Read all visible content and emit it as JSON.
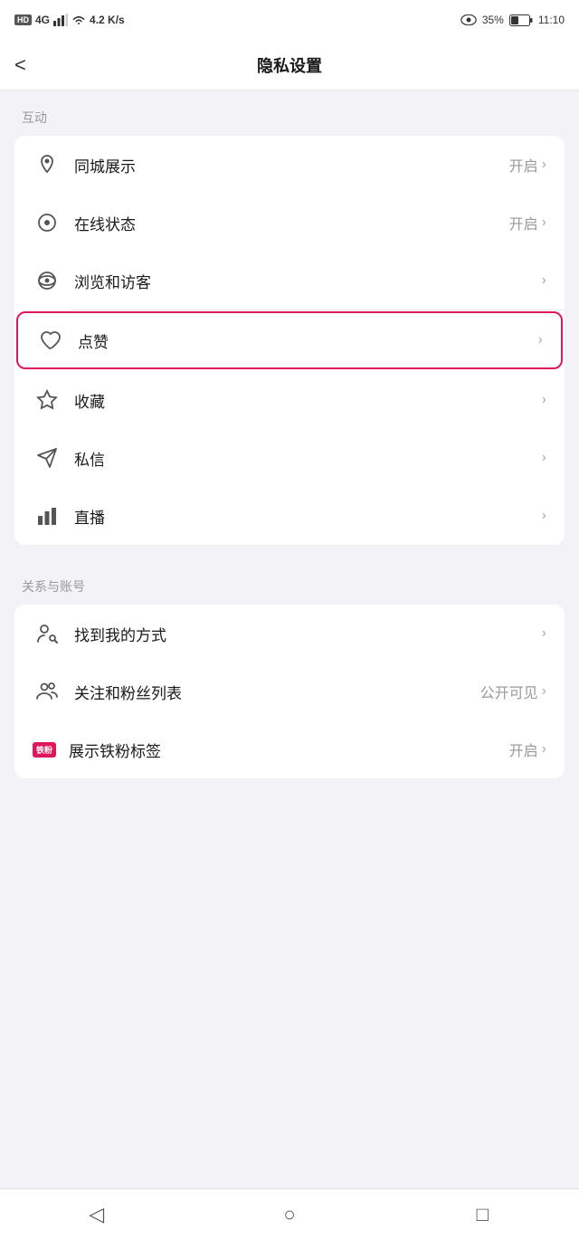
{
  "statusBar": {
    "hd": "HD",
    "signal": "4G",
    "networkSpeed": "4.2 K/s",
    "batteryPercent": "35%",
    "time": "11:10"
  },
  "navBar": {
    "title": "隐私设置",
    "backLabel": "<"
  },
  "sections": [
    {
      "header": "互动",
      "items": [
        {
          "id": "tongcheng",
          "icon": "location",
          "label": "同城展示",
          "value": "开启",
          "chevron": ">"
        },
        {
          "id": "online",
          "icon": "online",
          "label": "在线状态",
          "value": "开启",
          "chevron": ">"
        },
        {
          "id": "browse",
          "icon": "eye",
          "label": "浏览和访客",
          "value": "",
          "chevron": ">"
        },
        {
          "id": "likes",
          "icon": "heart",
          "label": "点赞",
          "value": "",
          "chevron": ">",
          "highlighted": true
        },
        {
          "id": "favorites",
          "icon": "star",
          "label": "收藏",
          "value": "",
          "chevron": ">"
        },
        {
          "id": "messages",
          "icon": "message",
          "label": "私信",
          "value": "",
          "chevron": ">"
        },
        {
          "id": "live",
          "icon": "bar",
          "label": "直播",
          "value": "",
          "chevron": ">"
        }
      ]
    },
    {
      "header": "关系与账号",
      "items": [
        {
          "id": "findme",
          "icon": "person-search",
          "label": "找到我的方式",
          "value": "",
          "chevron": ">"
        },
        {
          "id": "follow",
          "icon": "people",
          "label": "关注和粉丝列表",
          "value": "公开可见",
          "chevron": ">"
        },
        {
          "id": "tiefen",
          "icon": "tiefen-badge",
          "label": "展示铁粉标签",
          "value": "开启",
          "chevron": ">"
        }
      ]
    }
  ],
  "bottomNav": {
    "back": "◁",
    "home": "○",
    "square": "□"
  }
}
